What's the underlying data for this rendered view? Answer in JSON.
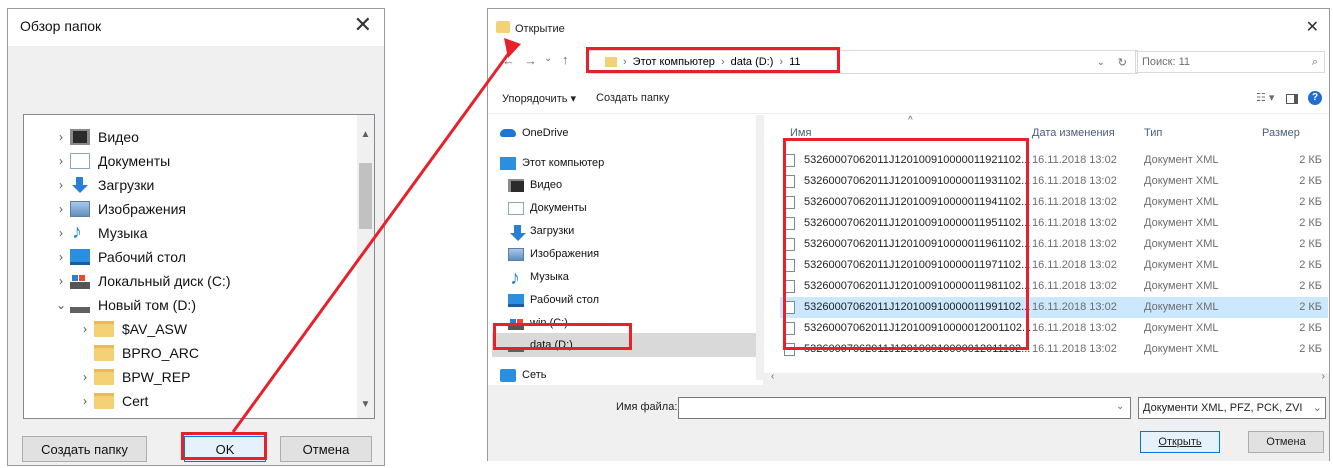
{
  "folder_dialog": {
    "title": "Обзор папок",
    "close": "✕",
    "tree": [
      {
        "label": "Видео",
        "icon": "video-icon",
        "chevron": "›"
      },
      {
        "label": "Документы",
        "icon": "documents-icon",
        "chevron": "›"
      },
      {
        "label": "Загрузки",
        "icon": "downloads-icon",
        "chevron": "›"
      },
      {
        "label": "Изображения",
        "icon": "pictures-icon",
        "chevron": "›"
      },
      {
        "label": "Музыка",
        "icon": "music-icon",
        "chevron": "›"
      },
      {
        "label": "Рабочий стол",
        "icon": "desktop-icon",
        "chevron": "›"
      },
      {
        "label": "Локальный диск (C:)",
        "icon": "local-disk-icon",
        "chevron": "›"
      },
      {
        "label": "Новый том (D:)",
        "icon": "volume-icon",
        "chevron": "⌄"
      },
      {
        "label": "$AV_ASW",
        "icon": "folder-icon",
        "chevron": "›"
      },
      {
        "label": "BPRO_ARC",
        "icon": "folder-icon",
        "chevron": ""
      },
      {
        "label": "BPW_REP",
        "icon": "folder-icon",
        "chevron": "›"
      },
      {
        "label": "Cert",
        "icon": "folder-icon",
        "chevron": "›"
      }
    ],
    "buttons": {
      "new_folder": "Создать папку",
      "ok": "OK",
      "cancel": "Отмена"
    }
  },
  "open_dialog": {
    "title": "Открытие",
    "close": "✕",
    "breadcrumb": [
      "Этот компьютер",
      "data (D:)",
      "11"
    ],
    "search_placeholder": "Поиск: 11",
    "toolbar": {
      "organize": "Упорядочить ▾",
      "new_folder": "Создать папку"
    },
    "nav": {
      "onedrive": "OneDrive",
      "this_pc": "Этот компьютер",
      "items": [
        "Видео",
        "Документы",
        "Загрузки",
        "Изображения",
        "Музыка",
        "Рабочий стол",
        "win (C:)",
        "data (D:)"
      ],
      "network": "Сеть"
    },
    "columns": {
      "name": "Имя",
      "date": "Дата изменения",
      "type": "Тип",
      "size": "Размер"
    },
    "files": [
      {
        "name": "53260007062011J12010091000001192110​2...",
        "date": "16.11.2018 13:02",
        "type": "Документ XML",
        "size": "2 КБ"
      },
      {
        "name": "53260007062011J12010091000001193110​2...",
        "date": "16.11.2018 13:02",
        "type": "Документ XML",
        "size": "2 КБ"
      },
      {
        "name": "53260007062011J12010091000001194110​2...",
        "date": "16.11.2018 13:02",
        "type": "Документ XML",
        "size": "2 КБ"
      },
      {
        "name": "53260007062011J12010091000001195110​2...",
        "date": "16.11.2018 13:02",
        "type": "Документ XML",
        "size": "2 КБ"
      },
      {
        "name": "53260007062011J12010091000001196110​2...",
        "date": "16.11.2018 13:02",
        "type": "Документ XML",
        "size": "2 КБ"
      },
      {
        "name": "53260007062011J12010091000001197110​2...",
        "date": "16.11.2018 13:02",
        "type": "Документ XML",
        "size": "2 КБ"
      },
      {
        "name": "53260007062011J12010091000001198110​2...",
        "date": "16.11.2018 13:02",
        "type": "Документ XML",
        "size": "2 КБ"
      },
      {
        "name": "53260007062011J12010091000001199110​2...",
        "date": "16.11.2018 13:02",
        "type": "Документ XML",
        "size": "2 КБ"
      },
      {
        "name": "53260007062011J12010091000001200110​2...",
        "date": "16.11.2018 13:02",
        "type": "Документ XML",
        "size": "2 КБ"
      },
      {
        "name": "53260007062011J12010091000001201110​2...",
        "date": "16.11.2018 13:02",
        "type": "Документ XML",
        "size": "2 КБ"
      }
    ],
    "selected_index": 7,
    "filename_label": "Имя файла:",
    "filename_value": "",
    "filetype": "Документи XML, PFZ, PCK, ZVI",
    "buttons": {
      "open": "Открыть",
      "cancel": "Отмена"
    }
  },
  "colors": {
    "annotation": "#e8202a",
    "selection": "#cce8ff",
    "link_blue": "#1a5ea0"
  }
}
